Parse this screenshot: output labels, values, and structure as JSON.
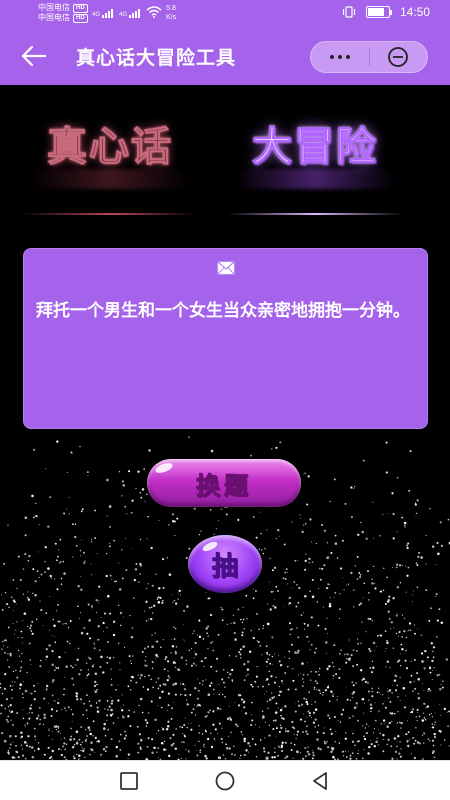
{
  "status_bar": {
    "carrier_1": "中国电信",
    "carrier_2": "中国电信",
    "hd_badge": "HD",
    "network_tag": "4G",
    "speed_value": "5.8",
    "speed_unit": "K/s",
    "time": "14:50",
    "icons": [
      "signal-icon",
      "wifi-icon",
      "vibrate-icon",
      "battery-icon"
    ]
  },
  "title_bar": {
    "title": "真心话大冒险工具",
    "back_icon": "back-arrow-icon",
    "capsule_icons": [
      "more-icon",
      "close-circle-icon"
    ]
  },
  "logos": {
    "truth": "真心话",
    "dare": "大冒险"
  },
  "card": {
    "icon": "envelope-icon",
    "question": "拜托一个男生和一个女生当众亲密地拥抱一分钟。"
  },
  "buttons": {
    "change": "换题",
    "draw": "抽"
  },
  "colors": {
    "accent": "#a463ea",
    "change_button": "#c22fc6",
    "draw_button": "#9c3ef4",
    "background": "#000000"
  },
  "nav_bar": {
    "icons": [
      "recent-apps-icon",
      "home-icon",
      "back-icon"
    ]
  }
}
